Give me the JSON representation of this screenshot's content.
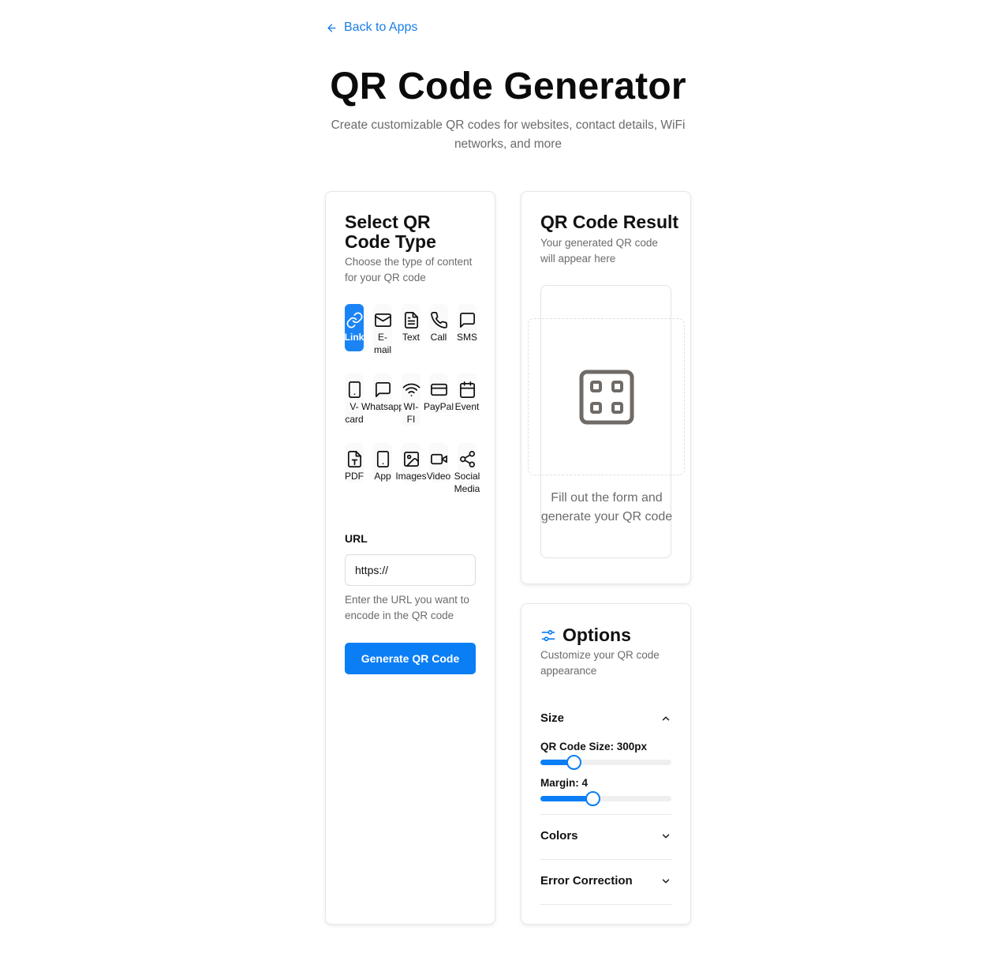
{
  "nav": {
    "back_label": "Back to Apps"
  },
  "header": {
    "title": "QR Code Generator",
    "subtitle": "Create customizable QR codes for websites, contact details, WiFi networks, and more"
  },
  "type_panel": {
    "title": "Select QR Code Type",
    "description": "Choose the type of content for your QR code",
    "types": [
      {
        "label": "Link",
        "icon": "link-icon",
        "active": true
      },
      {
        "label": "E-mail",
        "icon": "mail-icon"
      },
      {
        "label": "Text",
        "icon": "file-text-icon"
      },
      {
        "label": "Call",
        "icon": "phone-icon"
      },
      {
        "label": "SMS",
        "icon": "message-icon"
      },
      {
        "label": "V-card",
        "icon": "smartphone-icon"
      },
      {
        "label": "Whatsapp",
        "icon": "message-icon"
      },
      {
        "label": "WI-FI",
        "icon": "wifi-icon"
      },
      {
        "label": "PayPal",
        "icon": "credit-card-icon"
      },
      {
        "label": "Event",
        "icon": "calendar-icon"
      },
      {
        "label": "PDF",
        "icon": "file-type-icon"
      },
      {
        "label": "App",
        "icon": "smartphone-icon"
      },
      {
        "label": "Images",
        "icon": "image-icon"
      },
      {
        "label": "Video",
        "icon": "video-icon"
      },
      {
        "label": "Social Media",
        "icon": "share-icon"
      }
    ],
    "url_label": "URL",
    "url_value": "https://",
    "url_help": "Enter the URL you want to encode in the QR code",
    "generate_label": "Generate QR Code"
  },
  "result_panel": {
    "title": "QR Code Result",
    "description": "Your generated QR code will appear here",
    "placeholder_icon": "qr-code-icon",
    "empty_message": "Fill out the form and generate your QR code"
  },
  "options_panel": {
    "title": "Options",
    "description": "Customize your QR code appearance",
    "size_section": {
      "label": "Size",
      "qr_size_label": "QR Code Size: 300px",
      "qr_size_value": 0.25,
      "margin_label": "Margin: 4",
      "margin_value": 0.4
    },
    "colors_label": "Colors",
    "error_correction_label": "Error Correction"
  },
  "colors": {
    "accent": "#0a7ef5",
    "link": "#1a7ee6",
    "muted_text": "#6b6b6b"
  }
}
